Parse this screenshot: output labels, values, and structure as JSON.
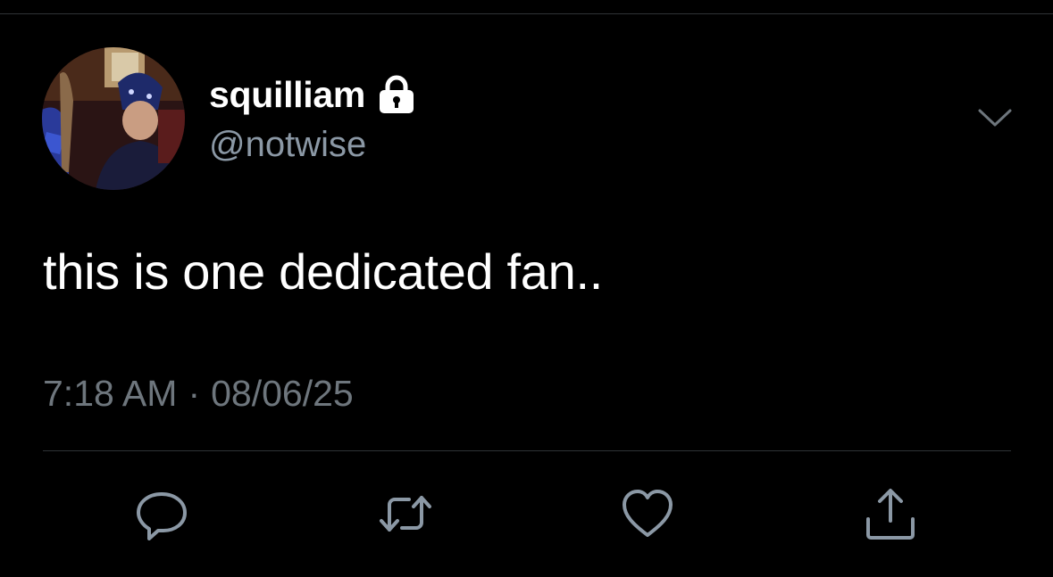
{
  "author": {
    "display_name": "squilliam",
    "handle": "@notwise",
    "protected_icon": "lock-icon",
    "avatar_icon": "profile-photo"
  },
  "tweet": {
    "text": "this is one dedicated fan..",
    "time": "7:18 AM",
    "separator": "·",
    "date": "08/06/25"
  },
  "actions": [
    {
      "name": "reply",
      "icon": "comment-icon"
    },
    {
      "name": "retweet",
      "icon": "retweet-icon"
    },
    {
      "name": "like",
      "icon": "heart-icon"
    },
    {
      "name": "share",
      "icon": "share-icon"
    }
  ],
  "colors": {
    "background": "#000000",
    "primary_text": "#ffffff",
    "secondary_text": "#6e767d",
    "handle_text": "#8b98a5",
    "icon": "#8b98a5",
    "divider": "#2f3336"
  }
}
